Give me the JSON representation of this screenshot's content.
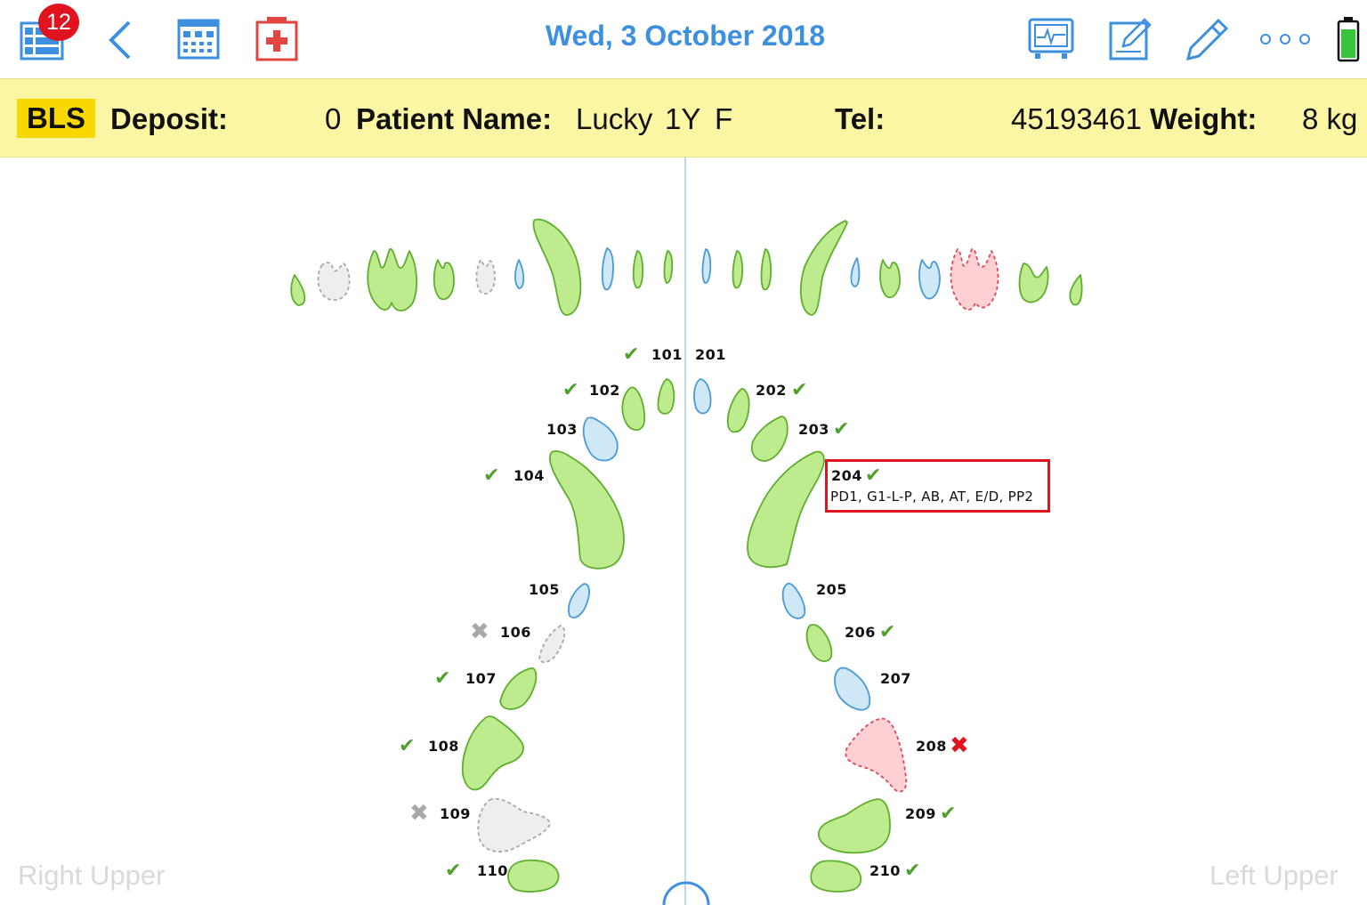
{
  "toolbar": {
    "badge_count": "12",
    "date": "Wed, 3 October 2018",
    "icons": [
      "list-icon",
      "back-chevron-icon",
      "calendar-icon",
      "medical-kit-icon",
      "monitor-icon",
      "edit-note-icon",
      "pencil-icon",
      "more-icon",
      "battery-icon"
    ],
    "accent": "#3d8fe0"
  },
  "patient": {
    "tag": "BLS",
    "deposit_label": "Deposit:",
    "deposit_value": "0",
    "name_label": "Patient Name:",
    "name": "Lucky",
    "age": "1Y",
    "sex": "F",
    "tel_label": "Tel:",
    "tel": "45193461",
    "weight_label": "Weight:",
    "weight": "8 kg"
  },
  "teeth": {
    "t101": {
      "label": "101",
      "mark": "check"
    },
    "t102": {
      "label": "102",
      "mark": "check"
    },
    "t103": {
      "label": "103",
      "mark": "none"
    },
    "t104": {
      "label": "104",
      "mark": "check"
    },
    "t105": {
      "label": "105",
      "mark": "none"
    },
    "t106": {
      "label": "106",
      "mark": "missing"
    },
    "t107": {
      "label": "107",
      "mark": "check"
    },
    "t108": {
      "label": "108",
      "mark": "check"
    },
    "t109": {
      "label": "109",
      "mark": "missing"
    },
    "t110": {
      "label": "110",
      "mark": "check"
    },
    "t201": {
      "label": "201",
      "mark": "none"
    },
    "t202": {
      "label": "202",
      "mark": "check"
    },
    "t203": {
      "label": "203",
      "mark": "check"
    },
    "t204": {
      "label": "204",
      "mark": "check",
      "detail": "PD1, G1-L-P, AB, AT, E/D, PP2"
    },
    "t205": {
      "label": "205",
      "mark": "none"
    },
    "t206": {
      "label": "206",
      "mark": "check"
    },
    "t207": {
      "label": "207",
      "mark": "none"
    },
    "t208": {
      "label": "208",
      "mark": "extract"
    },
    "t209": {
      "label": "209",
      "mark": "check"
    },
    "t210": {
      "label": "210",
      "mark": "check"
    }
  },
  "symbols": {
    "check": "✔",
    "missing": "✖",
    "extract": "✖"
  },
  "quadrants": {
    "left": "Right Upper",
    "right": "Left Upper"
  },
  "colors": {
    "healthy": "#bdeb8e",
    "treated": "#cfe8f8",
    "missing": "#eeeeee",
    "extract": "#fdd0d3",
    "check": "#4fa02e",
    "alert": "#e0141e"
  }
}
